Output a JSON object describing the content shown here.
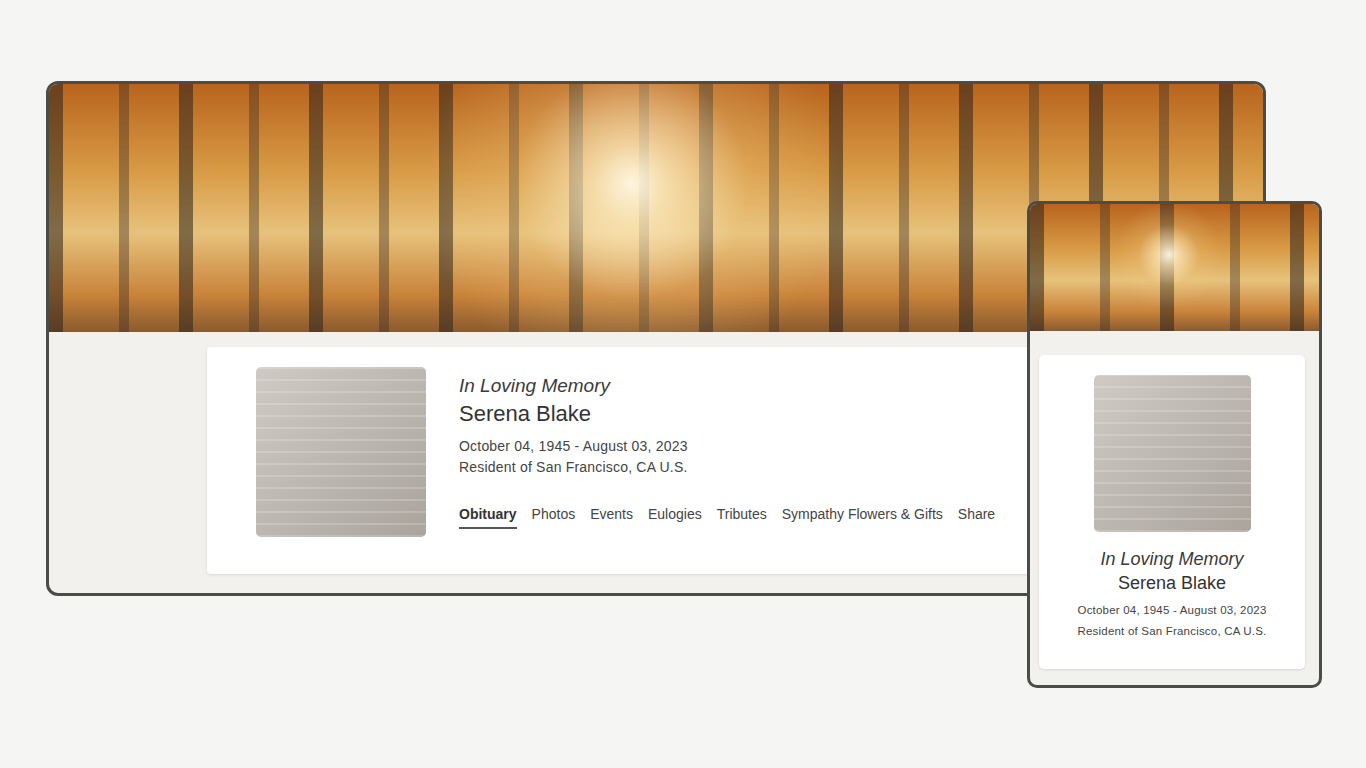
{
  "desktop": {
    "heading": "In Loving Memory",
    "name": "Serena Blake",
    "dates": "October 04, 1945 - August 03, 2023",
    "residence": "Resident of San Francisco, CA U.S.",
    "tabs": [
      {
        "label": "Obituary",
        "selected": true
      },
      {
        "label": "Photos",
        "selected": false
      },
      {
        "label": "Events",
        "selected": false
      },
      {
        "label": "Eulogies",
        "selected": false
      },
      {
        "label": "Tributes",
        "selected": false
      },
      {
        "label": "Sympathy Flowers & Gifts",
        "selected": false
      },
      {
        "label": "Share",
        "selected": false
      }
    ]
  },
  "mobile": {
    "heading": "In Loving Memory",
    "name": "Serena Blake",
    "dates": "October 04, 1945 - August 03, 2023",
    "residence": "Resident of San Francisco, CA U.S."
  }
}
